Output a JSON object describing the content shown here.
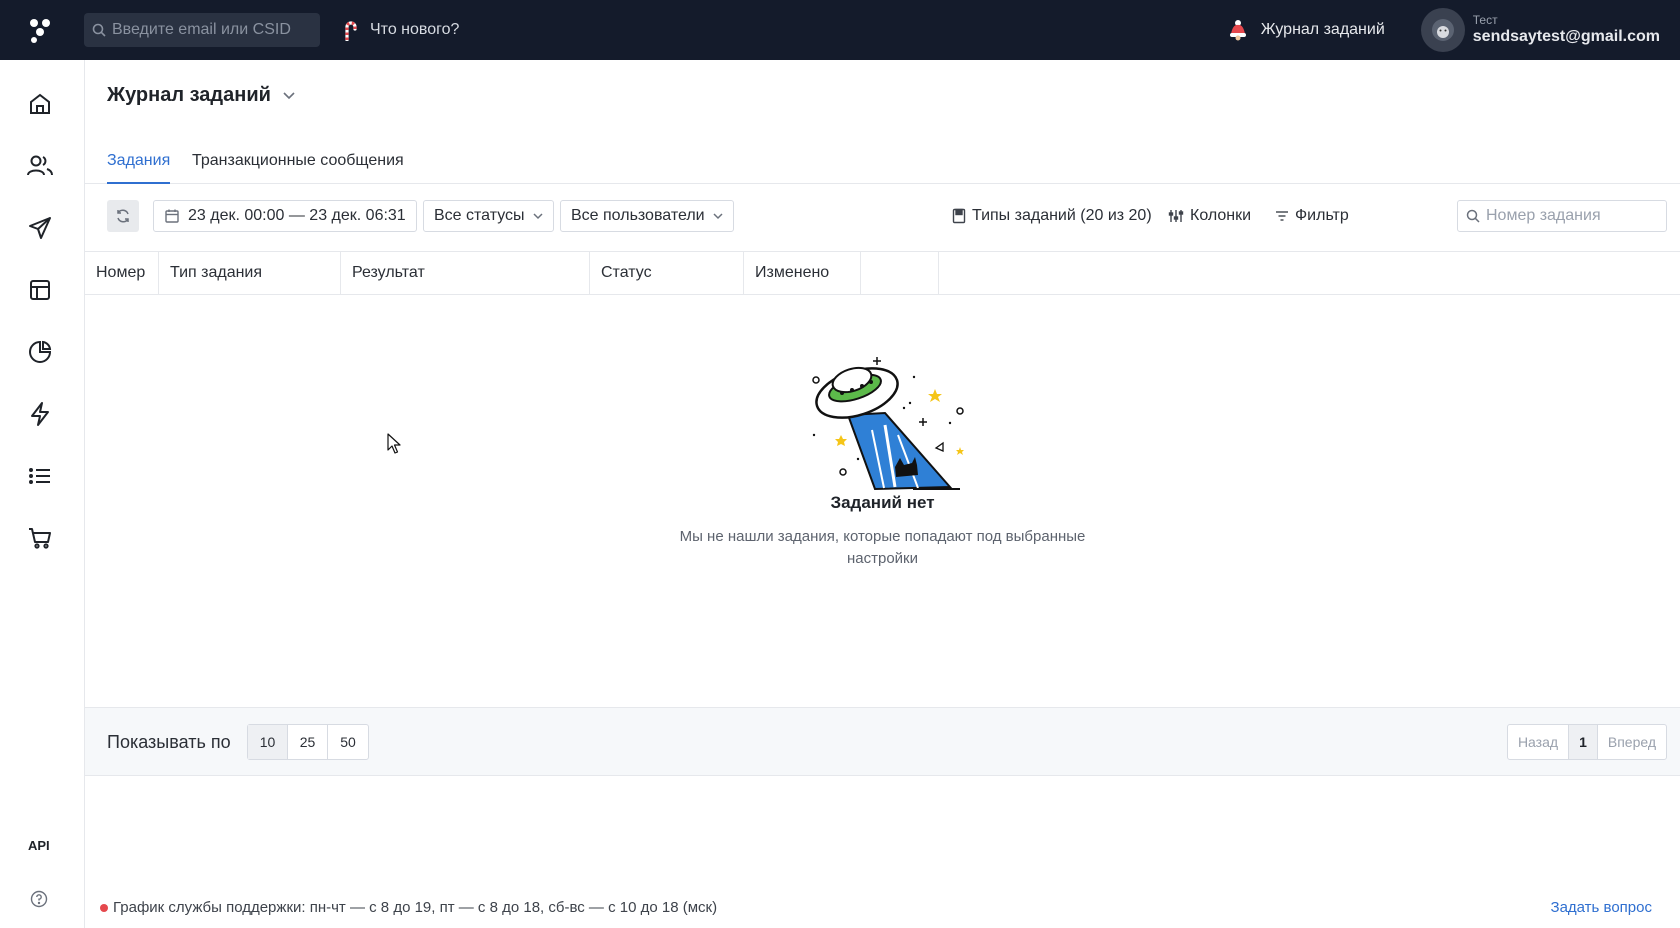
{
  "topbar": {
    "search_placeholder": "Введите email или CSID",
    "whats_new": "Что нового?",
    "journal_link": "Журнал заданий",
    "user_name": "Тест",
    "user_email": "sendsaytest@gmail.com"
  },
  "sidebar": {
    "items": [
      "home-icon",
      "users-icon",
      "send-icon",
      "layout-icon",
      "pie-chart-icon",
      "lightning-icon",
      "list-icon",
      "cart-icon"
    ],
    "api_label": "API",
    "help_icon": "question-icon"
  },
  "page": {
    "title": "Журнал заданий",
    "tabs": [
      {
        "label": "Задания",
        "active": true
      },
      {
        "label": "Транзакционные сообщения",
        "active": false
      }
    ]
  },
  "toolbar": {
    "date_range": "23 дек. 00:00 — 23 дек. 06:31",
    "status_filter": "Все статусы",
    "user_filter": "Все пользователи",
    "task_types": "Типы заданий (20 из 20)",
    "columns": "Колонки",
    "filter": "Фильтр",
    "number_placeholder": "Номер задания"
  },
  "table": {
    "columns": [
      "Номер",
      "Тип задания",
      "Результат",
      "Статус",
      "Изменено",
      ""
    ]
  },
  "empty": {
    "title": "Заданий нет",
    "description": "Мы не нашли задания, которые попадают под выбранные настройки"
  },
  "pager": {
    "show_label": "Показывать по",
    "sizes": [
      "10",
      "25",
      "50"
    ],
    "selected_size": "10",
    "prev": "Назад",
    "current": "1",
    "next": "Вперед"
  },
  "footer": {
    "schedule": "График службы поддержки: пн-чт — с 8 до 19, пт — с 8 до 18, сб-вс — с 10 до 18 (мск)",
    "ask": "Задать вопрос",
    "status_color": "#e5484d"
  },
  "colors": {
    "accent": "#2f6fd0",
    "topbar": "#141b2b"
  }
}
